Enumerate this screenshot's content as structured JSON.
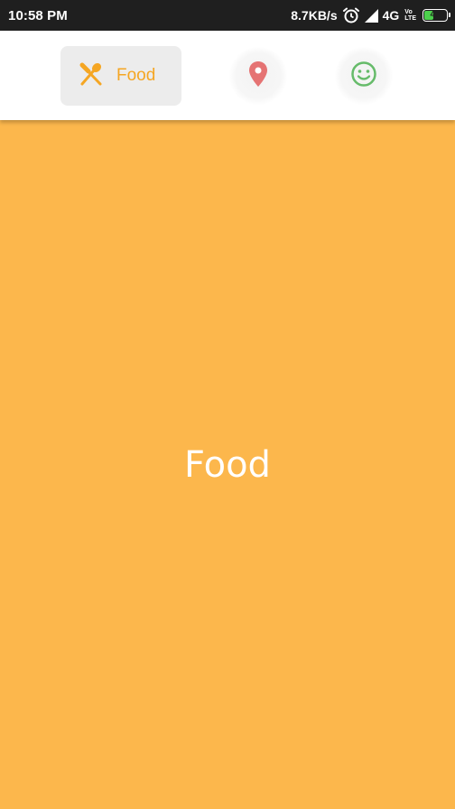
{
  "status_bar": {
    "time": "10:58 PM",
    "network_speed": "8.7KB/s",
    "network_type": "4G",
    "volte_top": "Vo",
    "volte_bottom": "LTE",
    "battery_level": "47",
    "battery_fraction": 0.47,
    "battery_color": "#4cd04c"
  },
  "tabs": [
    {
      "label": "Food",
      "icon": "fork-spoon-icon",
      "color": "#f5a623",
      "active": true
    },
    {
      "label": "",
      "icon": "location-pin-icon",
      "color": "#e57373",
      "active": false
    },
    {
      "label": "",
      "icon": "smile-icon",
      "color": "#66bb6a",
      "active": false
    }
  ],
  "content": {
    "title": "Food",
    "background_color": "#fcb74c"
  }
}
